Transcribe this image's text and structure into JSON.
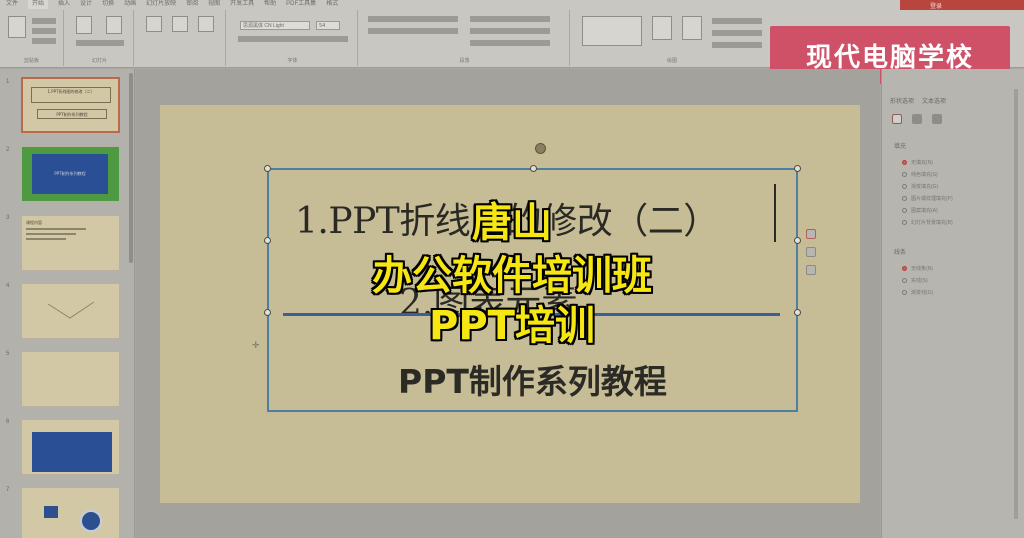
{
  "ribbon": {
    "tabs": [
      "文件",
      "开始",
      "插入",
      "设计",
      "切换",
      "动画",
      "幻灯片放映",
      "审阅",
      "视图",
      "开发工具",
      "帮助",
      "PDF工具集",
      "格式"
    ],
    "font_name": "思源黑体 CN Light",
    "font_size": "54",
    "groups": [
      "剪贴板",
      "幻灯片",
      "字体",
      "段落",
      "绘图"
    ],
    "account_label": "登录"
  },
  "watermark": {
    "text": "现代电脑学校"
  },
  "thumbnails": {
    "numbers": [
      "1",
      "2",
      "3",
      "4",
      "5",
      "6",
      "7"
    ],
    "slide1_lines": [
      "1.PPT折线图的修改（二）",
      "2.图表元素",
      "PPT制作系列教程"
    ],
    "slide2_text": "PPT制作系列教程",
    "slide3_heading": "课程内容"
  },
  "slide": {
    "title_line1": "1.PPT折线图的修改（二）",
    "title_line2": "2.图表元素",
    "subtitle": "PPT制作系列教程"
  },
  "caption": {
    "line1": "唐山",
    "line2": "办公软件培训班",
    "line3": "PPT培训"
  },
  "right_pane": {
    "tabs": [
      "形状选项",
      "文本选项"
    ],
    "fill_heading": "填充",
    "fill_options": [
      "无填充(N)",
      "纯色填充(S)",
      "渐变填充(G)",
      "图片或纹理填充(P)",
      "图案填充(A)",
      "幻灯片背景填充(B)"
    ],
    "line_heading": "线条",
    "line_options": [
      "无线条(N)",
      "实线(S)",
      "渐变线(G)"
    ]
  },
  "colors": {
    "caption_yellow": "#f6e612",
    "watermark_bg": "#cf5168",
    "selection_border": "#4e7fa3",
    "divider_blue": "#3c5f99"
  }
}
